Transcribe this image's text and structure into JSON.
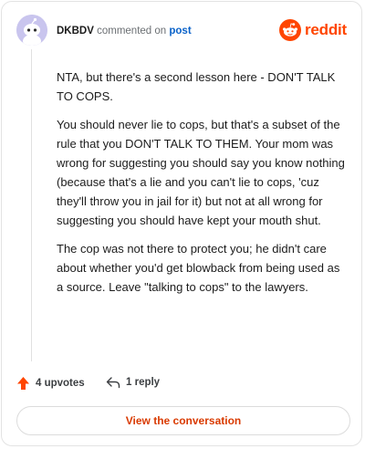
{
  "comment": {
    "author": "DKBDV",
    "action_text": "commented on",
    "post_link_text": "post",
    "paragraphs": [
      "NTA, but there's a second lesson here - DON'T TALK TO COPS.",
      "You should never lie to cops, but that's a subset of the rule that you DON'T TALK TO THEM. Your mom was wrong for suggesting you should say you know nothing (because that's a lie and you can't lie to cops, 'cuz they'll throw you in jail for it) but not at all wrong for suggesting you should have kept your mouth shut.",
      "The cop was not there to protect you; he didn't care about whether you'd get blowback from being used as a source. Leave \"talking to cops\" to the lawyers."
    ],
    "upvotes_label": "4 upvotes",
    "replies_label": "1 reply"
  },
  "brand": {
    "wordmark": "reddit",
    "color": "#ff4500"
  },
  "colors": {
    "link": "#0a62c9",
    "cta_text": "#d93a00",
    "avatar_bg": "#c9c5ee"
  },
  "icons": {
    "avatar": "snoo-avatar-icon",
    "logo": "reddit-snoo-icon",
    "upvote": "upvote-arrow-icon",
    "reply": "reply-arrow-icon"
  },
  "cta": {
    "label": "View the conversation"
  }
}
